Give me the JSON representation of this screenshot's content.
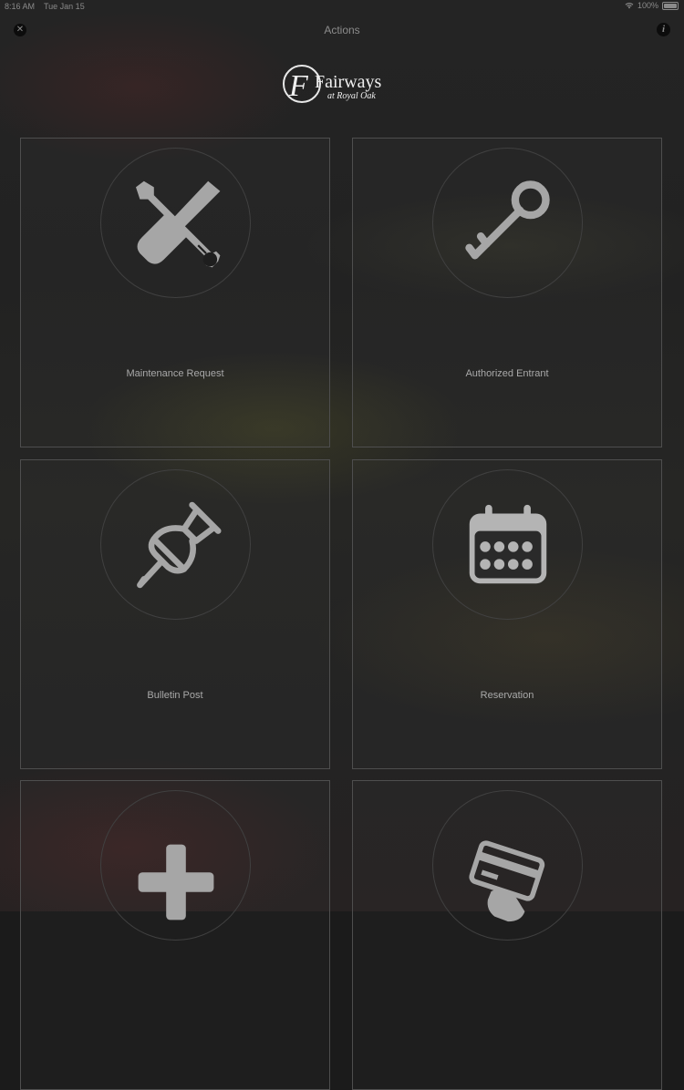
{
  "status": {
    "time": "8:16 AM",
    "date": "Tue Jan 15",
    "battery": "100%"
  },
  "header": {
    "title": "Actions",
    "close_icon": "close-icon",
    "info_icon": "info-icon"
  },
  "logo": {
    "name": "Fairways",
    "sub": "at Royal Oak",
    "monogram": "F"
  },
  "actions": [
    {
      "label": "Maintenance Request",
      "icon": "wrench-screwdriver-icon"
    },
    {
      "label": "Authorized Entrant",
      "icon": "key-icon"
    },
    {
      "label": "Bulletin Post",
      "icon": "pushpin-icon"
    },
    {
      "label": "Reservation",
      "icon": "calendar-icon"
    },
    {
      "label": "",
      "icon": "plus-icon"
    },
    {
      "label": "",
      "icon": "credit-card-icon"
    }
  ],
  "colors": {
    "background": "#1b1b1b",
    "icon": "#a6a6a6",
    "text": "#a9a9a9",
    "border": "#4e4e4e"
  }
}
